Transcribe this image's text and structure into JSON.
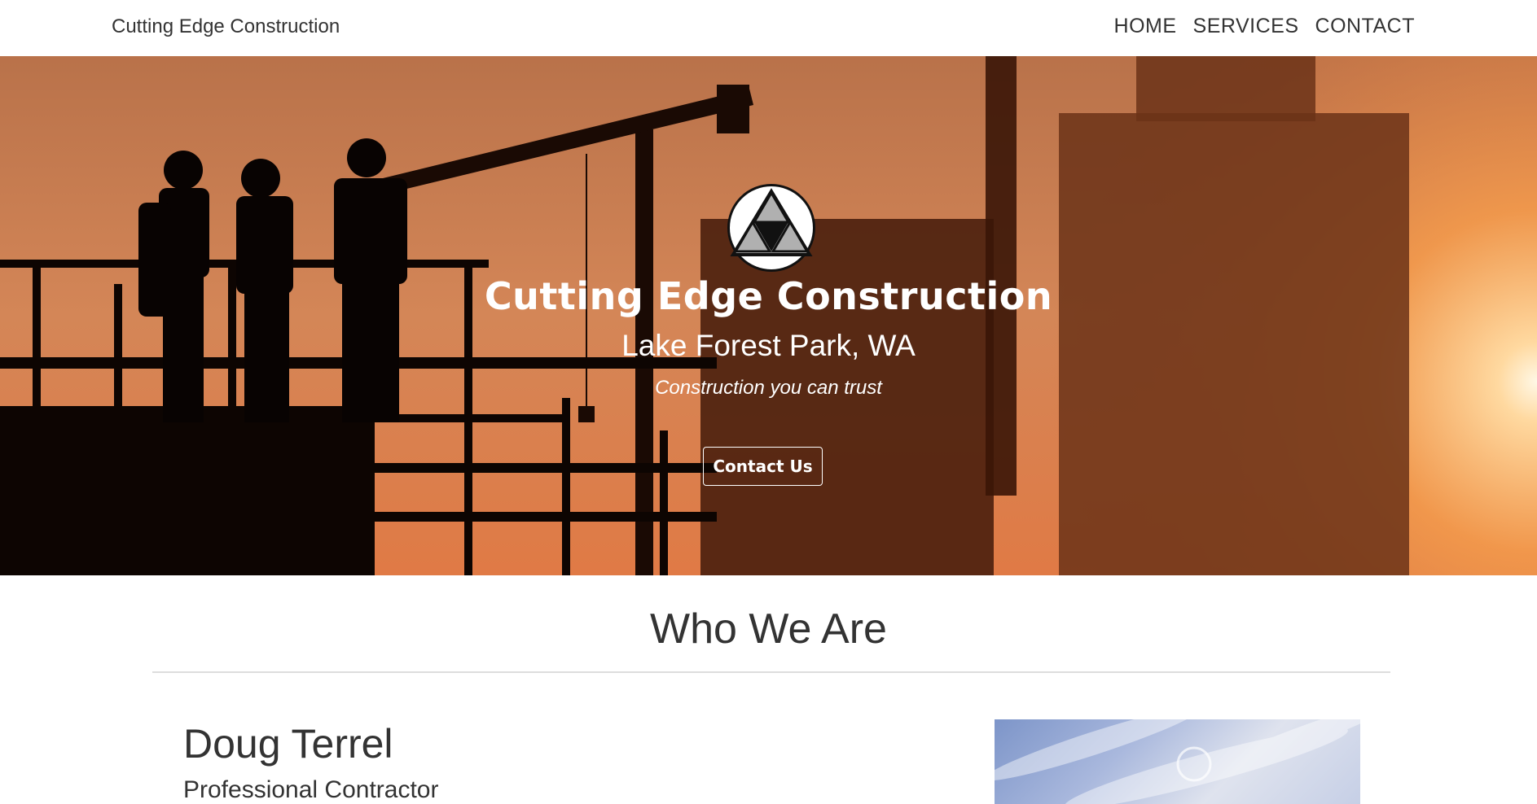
{
  "navbar": {
    "brand": "Cutting Edge Construction",
    "links": [
      "HOME",
      "SERVICES",
      "CONTACT"
    ]
  },
  "hero": {
    "logo_icon": "triangle-logo-icon",
    "title": "Cutting Edge Construction",
    "location": "Lake Forest Park, WA",
    "tagline": "Construction you can trust",
    "button_label": "Contact Us"
  },
  "about": {
    "section_title": "Who We Are",
    "person": {
      "name": "Doug Terrel",
      "role": "Professional Contractor"
    }
  }
}
